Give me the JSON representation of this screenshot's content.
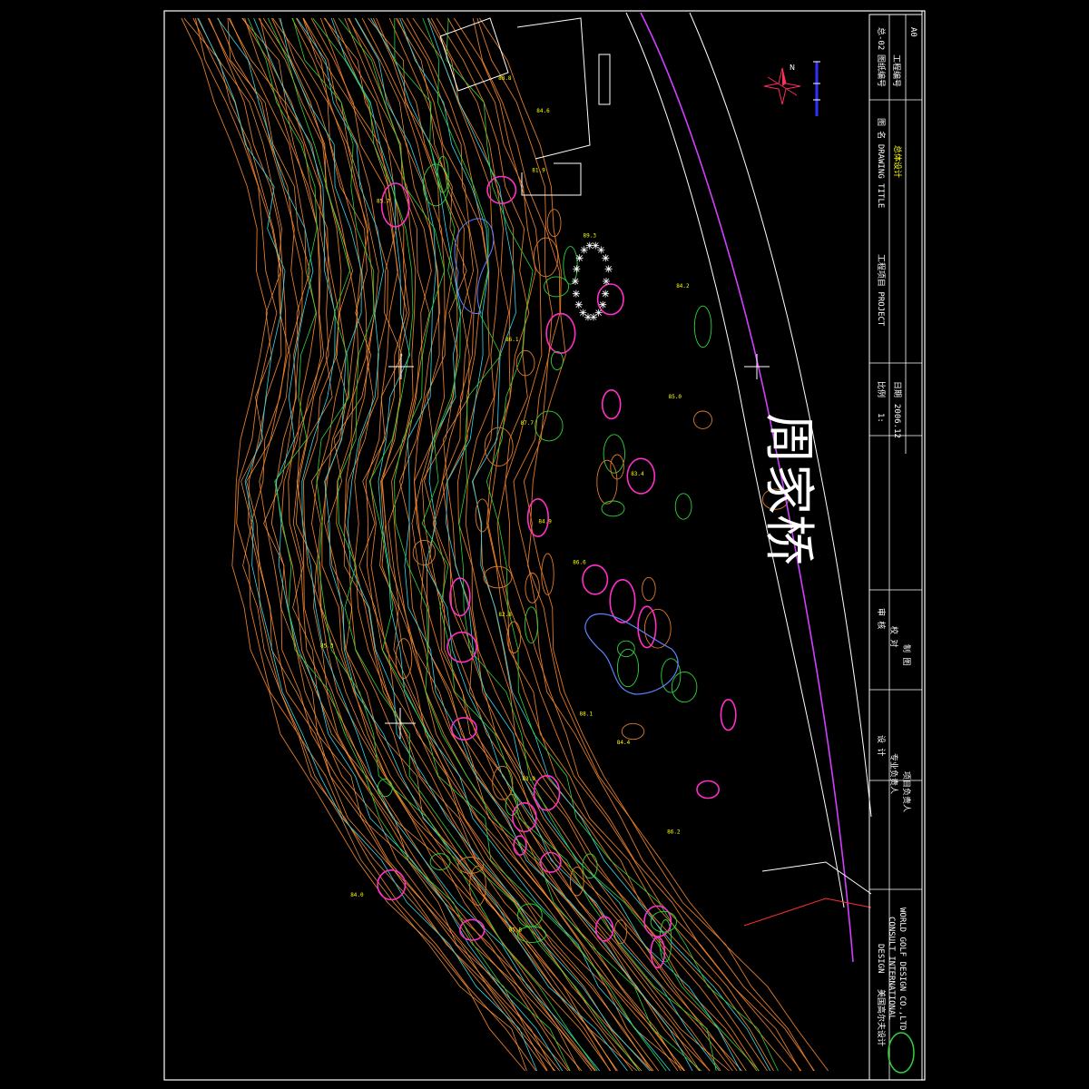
{
  "street_label": "周家桥",
  "title_block": {
    "company": {
      "cn_name": "美国高尔夫设计",
      "en_line1": "DESIGN",
      "en_line2": "CONSULT INTERNATIONAL",
      "en_line3": "WORLD GOLF DESIGN CO.,LTD"
    },
    "approvals": [
      "审 核",
      "校 对",
      "制 图",
      "设 计",
      "专业负责人",
      "项目负责人"
    ],
    "scale_label": "比例",
    "scale_value": "1:",
    "date_label": "日期",
    "date_value": "2006.12",
    "project_label": "工程项目 PROJECT",
    "drawing_title_label": "图 名 DRAWING TITLE",
    "drawing_title_value": "总体设计",
    "drawing_no_label": "图纸编号",
    "drawing_no_value": "总-02",
    "project_no_label": "工程编号",
    "sheet_size": "A0"
  },
  "elevation_samples": [
    "88.8",
    "84.6",
    "81.9",
    "85.7",
    "89.3",
    "84.2",
    "86.1",
    "85.0",
    "87.7",
    "83.4",
    "84.9",
    "86.6",
    "82.8",
    "85.3",
    "88.1",
    "84.4",
    "83.9",
    "86.2",
    "84.0",
    "85.8"
  ],
  "colors": {
    "contour_main": "#e07a2a",
    "contour_alt": "#ff9a40",
    "contour_cyan": "#35d6e8",
    "contour_green": "#2fd23a",
    "magenta": "#ff2fc8",
    "road": "#d040ff",
    "frame": "#ffffff",
    "spot_text": "#ffff00"
  }
}
